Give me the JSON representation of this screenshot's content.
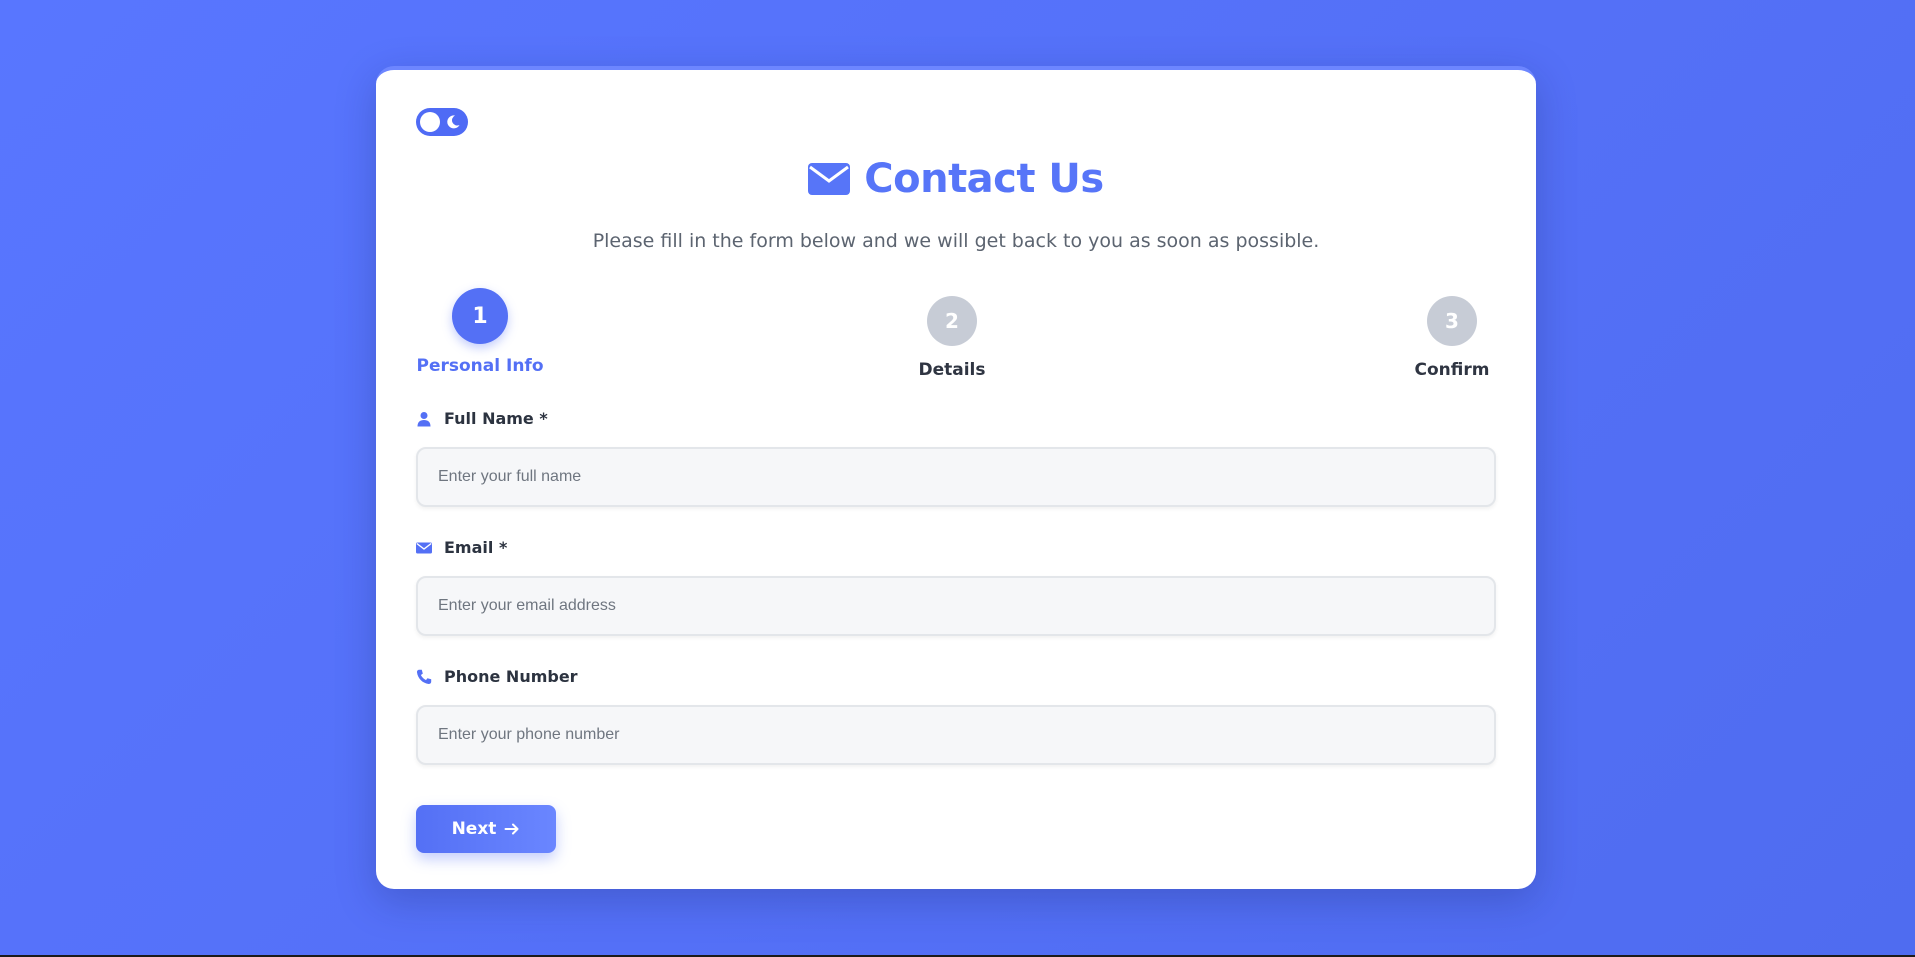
{
  "header": {
    "title": "Contact Us",
    "subtitle": "Please fill in the form below and we will get back to you as soon as possible."
  },
  "theme_toggle": {
    "icon": "moon-icon",
    "state": "light"
  },
  "steps": [
    {
      "number": "1",
      "label": "Personal Info",
      "active": true
    },
    {
      "number": "2",
      "label": "Details",
      "active": false
    },
    {
      "number": "3",
      "label": "Confirm",
      "active": false
    }
  ],
  "form": {
    "full_name": {
      "label": "Full Name *",
      "placeholder": "Enter your full name",
      "icon": "user-icon"
    },
    "email": {
      "label": "Email *",
      "placeholder": "Enter your email address",
      "icon": "envelope-icon"
    },
    "phone": {
      "label": "Phone Number",
      "placeholder": "Enter your phone number",
      "icon": "phone-icon"
    }
  },
  "actions": {
    "next_label": "Next",
    "next_icon": "arrow-right-icon"
  },
  "colors": {
    "accent": "#5470f5",
    "background": "#5876ff",
    "inactive_step": "#c7ccd6"
  }
}
